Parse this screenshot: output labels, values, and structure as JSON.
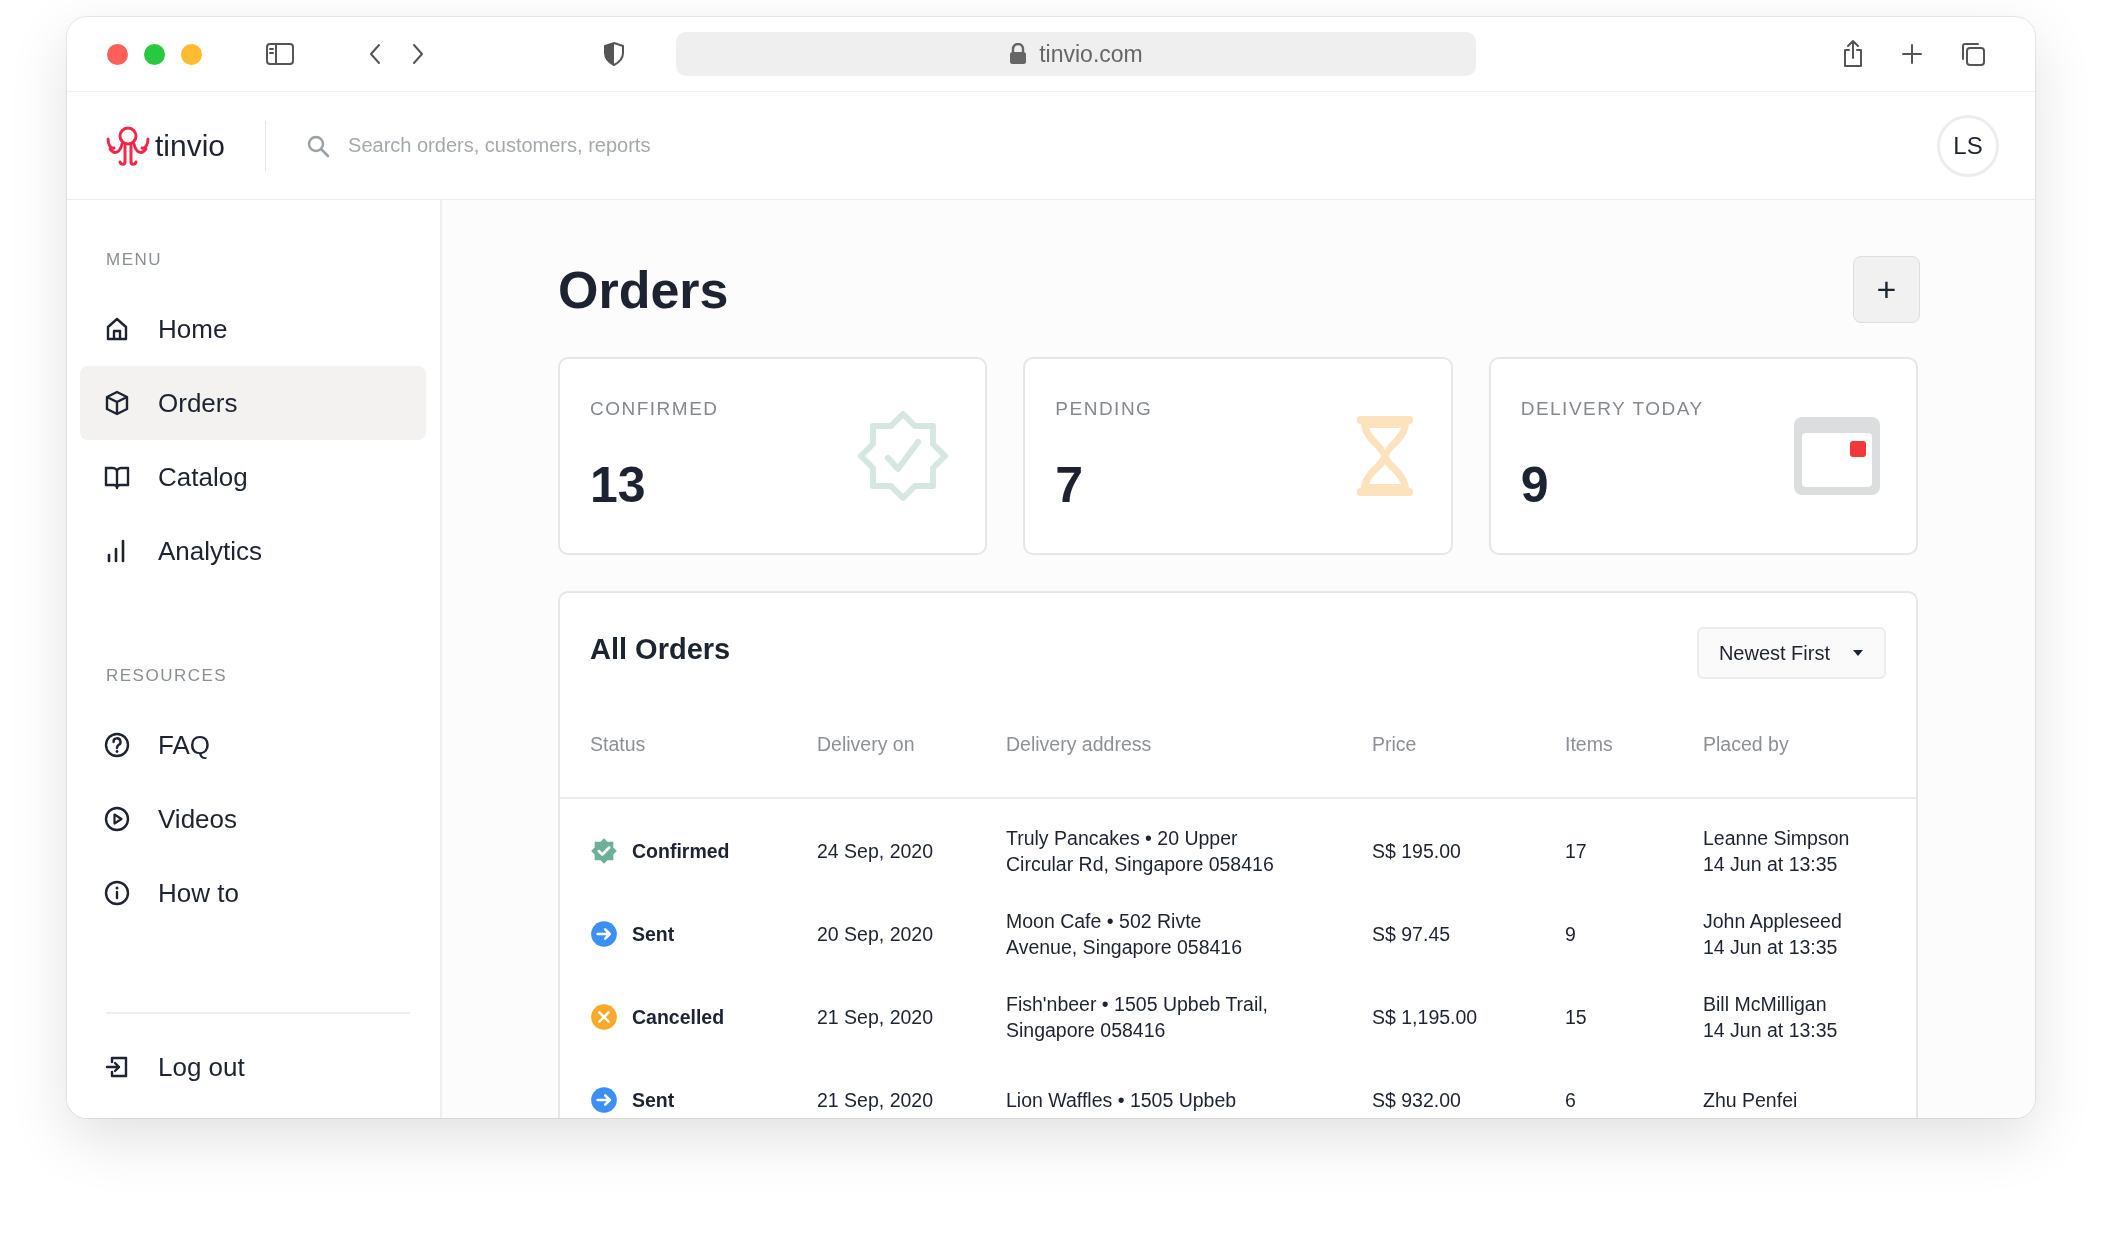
{
  "browser": {
    "url": "tinvio.com"
  },
  "header": {
    "logo": "tinvio",
    "search": {
      "placeholder": "Search orders, customers, reports"
    },
    "avatar": "LS"
  },
  "sidebar": {
    "sections": [
      {
        "heading": "MENU",
        "items": [
          {
            "label": "Home",
            "kind": "home",
            "selected": false
          },
          {
            "label": "Orders",
            "kind": "box",
            "selected": true
          },
          {
            "label": "Catalog",
            "kind": "book",
            "selected": false
          },
          {
            "label": "Analytics",
            "kind": "bars",
            "selected": false
          }
        ]
      },
      {
        "heading": "RESOURCES",
        "items": [
          {
            "label": "FAQ",
            "kind": "question",
            "selected": false
          },
          {
            "label": "Videos",
            "kind": "play",
            "selected": false
          },
          {
            "label": "How to",
            "kind": "info",
            "selected": false
          }
        ]
      }
    ],
    "footer_item": {
      "label": "Log out",
      "kind": "logout"
    }
  },
  "page": {
    "title": "Orders",
    "add_button": "+"
  },
  "stats": [
    {
      "label": "CONFIRMED",
      "value": "13",
      "kind": "badge"
    },
    {
      "label": "PENDING",
      "value": "7",
      "kind": "hourglass"
    },
    {
      "label": "DELIVERY TODAY",
      "value": "9",
      "kind": "calendar"
    }
  ],
  "orders": {
    "title": "All Orders",
    "sort": "Newest First",
    "columns": [
      "Status",
      "Delivery on",
      "Delivery address",
      "Price",
      "Items",
      "Placed by"
    ],
    "rows": [
      {
        "status": "Confirmed",
        "kind": "confirmed",
        "delivery_on": "24 Sep, 2020",
        "address": [
          "Truly Pancakes • 20 Upper",
          "Circular Rd, Singapore 058416"
        ],
        "price": "S$ 195.00",
        "items": "17",
        "placed_by": [
          "Leanne Simpson",
          "14 Jun at 13:35"
        ]
      },
      {
        "status": "Sent",
        "kind": "sent",
        "delivery_on": "20 Sep, 2020",
        "address": [
          "Moon Cafe • 502 Rivte",
          "Avenue, Singapore 058416"
        ],
        "price": "S$ 97.45",
        "items": "9",
        "placed_by": [
          "John Appleseed",
          "14 Jun at 13:35"
        ]
      },
      {
        "status": "Cancelled",
        "kind": "cancelled",
        "delivery_on": "21 Sep, 2020",
        "address": [
          "Fish'nbeer • 1505 Upbeb Trail,",
          "Singapore 058416"
        ],
        "price": "S$ 1,195.00",
        "items": "15",
        "placed_by": [
          "Bill McMilligan",
          "14 Jun at 13:35"
        ]
      },
      {
        "status": "Sent",
        "kind": "sent",
        "delivery_on": "21 Sep, 2020",
        "address": [
          "Lion Waffles • 1505 Upbeb"
        ],
        "price": "S$ 932.00",
        "items": "6",
        "placed_by": [
          "Zhu Penfei"
        ]
      }
    ]
  }
}
